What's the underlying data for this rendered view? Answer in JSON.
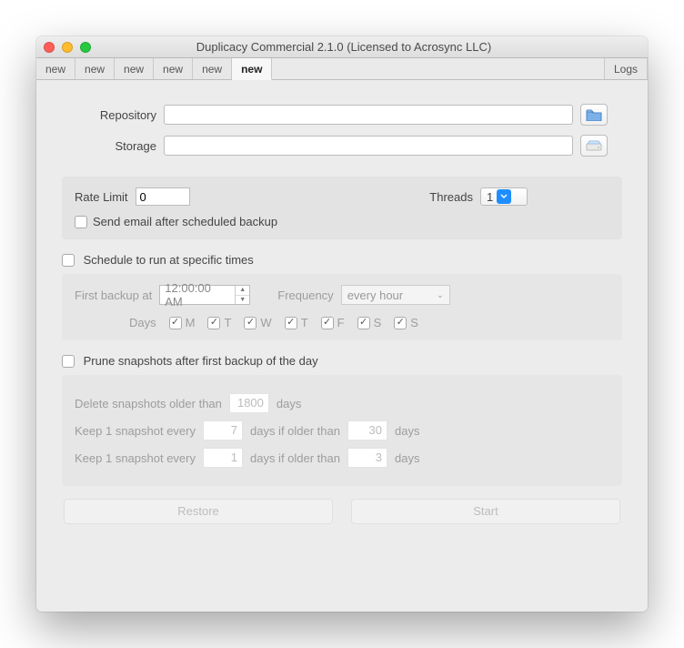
{
  "window_title": "Duplicacy Commercial 2.1.0 (Licensed to Acrosync LLC)",
  "tabs": {
    "t0": "new",
    "t1": "new",
    "t2": "new",
    "t3": "new",
    "t4": "new",
    "t5": "new",
    "logs": "Logs"
  },
  "paths": {
    "repo_label": "Repository",
    "repo_value": "",
    "storage_label": "Storage",
    "storage_value": ""
  },
  "rate": {
    "label": "Rate Limit",
    "value": "0",
    "threads_label": "Threads",
    "threads_value": "1",
    "email_label": "Send email after scheduled backup"
  },
  "schedule": {
    "enable_label": "Schedule to run at specific times",
    "first_label": "First backup at",
    "first_value": "12:00:00 AM",
    "freq_label": "Frequency",
    "freq_value": "every hour",
    "days_label": "Days",
    "day_m": "M",
    "day_t1": "T",
    "day_w": "W",
    "day_t2": "T",
    "day_f": "F",
    "day_s1": "S",
    "day_s2": "S"
  },
  "prune": {
    "enable_label": "Prune snapshots after first backup of the day",
    "del_a": "Delete snapshots older than",
    "del_v": "1800",
    "del_b": "days",
    "k1_a": "Keep 1 snapshot every",
    "k1_v": "7",
    "k1_b": "days if older than",
    "k1_v2": "30",
    "k1_c": "days",
    "k2_a": "Keep 1 snapshot every",
    "k2_v": "1",
    "k2_b": "days if older than",
    "k2_v2": "3",
    "k2_c": "days"
  },
  "buttons": {
    "restore": "Restore",
    "start": "Start"
  }
}
